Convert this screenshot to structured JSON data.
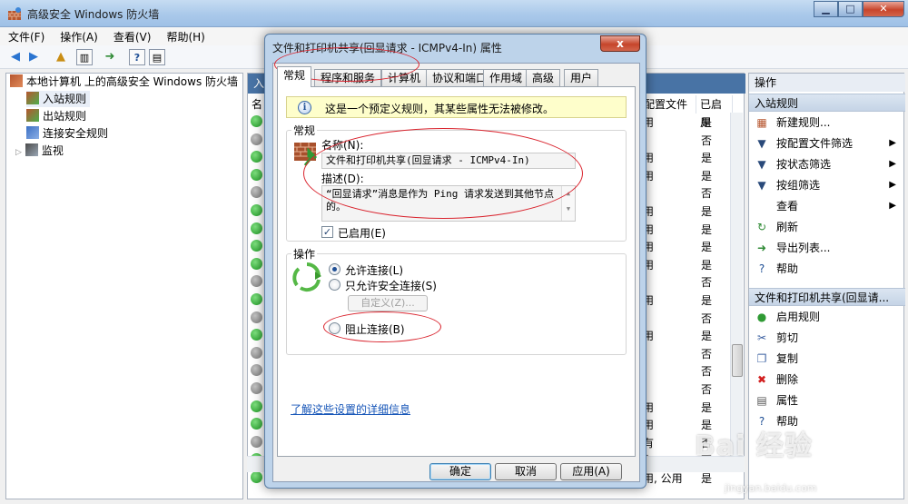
{
  "window": {
    "title": "高级安全 Windows 防火墙"
  },
  "menu": [
    "文件(F)",
    "操作(A)",
    "查看(V)",
    "帮助(H)"
  ],
  "tree": {
    "root": "本地计算机 上的高级安全 Windows 防火墙",
    "items": [
      "入站规则",
      "出站规则",
      "连接安全规则",
      "监视"
    ]
  },
  "list": {
    "header_partial": "入",
    "col_name_partial": "名",
    "col_profile": "配置文件",
    "col_enabled": "已启用",
    "rows": [
      {
        "profile": "用",
        "enabled": "是",
        "status": "green"
      },
      {
        "profile": "",
        "enabled": "否",
        "status": "gray"
      },
      {
        "profile": "用",
        "enabled": "是",
        "status": "green"
      },
      {
        "profile": "用",
        "enabled": "是",
        "status": "green"
      },
      {
        "profile": "",
        "enabled": "否",
        "status": "gray"
      },
      {
        "profile": "用",
        "enabled": "是",
        "status": "green"
      },
      {
        "profile": "用",
        "enabled": "是",
        "status": "green"
      },
      {
        "profile": "用",
        "enabled": "是",
        "status": "green"
      },
      {
        "profile": "用",
        "enabled": "是",
        "status": "green"
      },
      {
        "profile": "",
        "enabled": "否",
        "status": "gray"
      },
      {
        "profile": "用",
        "enabled": "是",
        "status": "green"
      },
      {
        "profile": "",
        "enabled": "否",
        "status": "gray"
      },
      {
        "profile": "用",
        "enabled": "是",
        "status": "green"
      },
      {
        "profile": "",
        "enabled": "否",
        "status": "gray"
      },
      {
        "profile": "",
        "enabled": "否",
        "status": "gray"
      },
      {
        "profile": "",
        "enabled": "否",
        "status": "gray"
      },
      {
        "profile": "用",
        "enabled": "是",
        "status": "green"
      },
      {
        "profile": "用",
        "enabled": "是",
        "status": "green"
      },
      {
        "profile": "有",
        "enabled": "否",
        "status": "gray"
      },
      {
        "profile": "有",
        "enabled": "否",
        "status": "green"
      },
      {
        "profile": "用, 公用",
        "enabled": "是",
        "status": "green"
      }
    ]
  },
  "actions": {
    "title": "操作",
    "section1": "入站规则",
    "section1_items": [
      {
        "label": "新建规则...",
        "icon": "new-rule-icon",
        "arrow": false
      },
      {
        "label": "按配置文件筛选",
        "icon": "filter-icon",
        "arrow": true
      },
      {
        "label": "按状态筛选",
        "icon": "filter-icon",
        "arrow": true
      },
      {
        "label": "按组筛选",
        "icon": "filter-icon",
        "arrow": true
      },
      {
        "label": "查看",
        "icon": "view-icon",
        "arrow": true
      },
      {
        "label": "刷新",
        "icon": "refresh-icon",
        "arrow": false
      },
      {
        "label": "导出列表...",
        "icon": "export-icon",
        "arrow": false
      },
      {
        "label": "帮助",
        "icon": "help-icon",
        "arrow": false
      }
    ],
    "section2": "文件和打印机共享(回显请...",
    "section2_items": [
      {
        "label": "启用规则",
        "icon": "enable-rule-icon"
      },
      {
        "label": "剪切",
        "icon": "cut-icon"
      },
      {
        "label": "复制",
        "icon": "copy-icon"
      },
      {
        "label": "删除",
        "icon": "delete-icon"
      },
      {
        "label": "属性",
        "icon": "properties-icon"
      },
      {
        "label": "帮助",
        "icon": "help-icon"
      }
    ]
  },
  "dialog": {
    "title": "文件和打印机共享(回显请求 - ICMPv4-In) 属性",
    "close": "x",
    "tabs": [
      "常规",
      "程序和服务",
      "计算机",
      "协议和端口",
      "作用域",
      "高级",
      "用户"
    ],
    "info": "这是一个预定义规则，其某些属性无法被修改。",
    "general": {
      "group_label": "常规",
      "name_label": "名称(N):",
      "name_value": "文件和打印机共享(回显请求 - ICMPv4-In)",
      "desc_label": "描述(D):",
      "desc_value": "“回显请求”消息是作为 Ping 请求发送到其他节点的。",
      "enabled_label": "已启用(E)",
      "enabled": true
    },
    "action": {
      "group_label": "操作",
      "allow": "允许连接(L)",
      "secure_only": "只允许安全连接(S)",
      "customize": "自定义(Z)...",
      "block": "阻止连接(B)",
      "selected": "allow"
    },
    "link": "了解这些设置的详细信息",
    "buttons": {
      "ok": "确定",
      "cancel": "取消",
      "apply": "应用(A)"
    }
  },
  "watermark": {
    "main": "Bai 经验",
    "sub": "jingyan.baidu.com"
  },
  "colors": {
    "accent": "#4873a5",
    "annotation": "#d9232d"
  }
}
